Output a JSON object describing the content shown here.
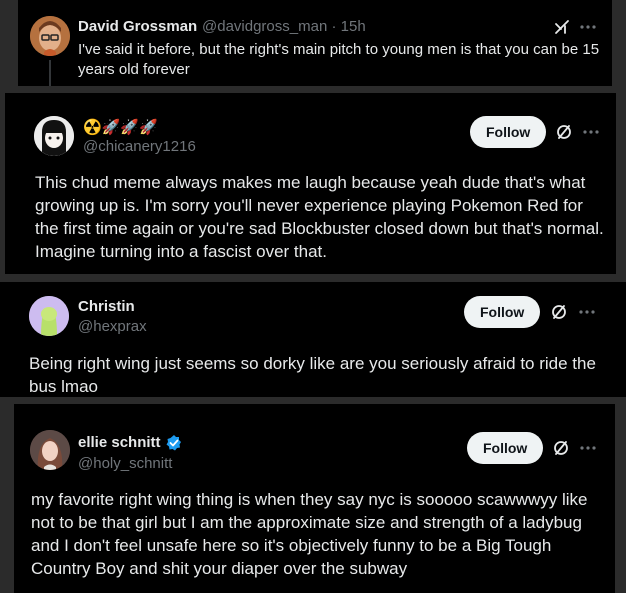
{
  "posts": [
    {
      "name": "David Grossman",
      "handle": "@davidgross_man",
      "time": "15h",
      "text": "I've said it before, but the right's main pitch to young men is that you can be 15 years old forever"
    },
    {
      "name": "☢️🚀🚀🚀",
      "handle": "@chicanery1216",
      "follow_label": "Follow",
      "text": "This chud meme always makes me laugh because yeah dude that's what growing up is. I'm sorry you'll never experience playing Pokemon Red for the first time again or you're sad Blockbuster closed down but that's normal. Imagine turning into  a fascist over that."
    },
    {
      "name": "Christin",
      "handle": "@hexprax",
      "follow_label": "Follow",
      "text": "Being right wing just seems so dorky like are you seriously afraid to ride the bus lmao"
    },
    {
      "name": "ellie schnitt",
      "handle": "@holy_schnitt",
      "follow_label": "Follow",
      "text": "my favorite right wing thing is when they say nyc is sooooo scawwwyy like not to be that girl but I am the approximate size and strength of a ladybug and I don't feel unsafe here so it's objectively funny to be a Big Tough Country Boy and shit your diaper over the subway"
    }
  ],
  "icons": [
    "grok-icon",
    "more-icon",
    "translate-icon",
    "verified-badge-icon"
  ],
  "colors": {
    "background": "#000000",
    "text": "#e7e9ea",
    "muted": "#71767b",
    "follow_bg": "#eff3f4",
    "verified": "#1d9bf0"
  }
}
